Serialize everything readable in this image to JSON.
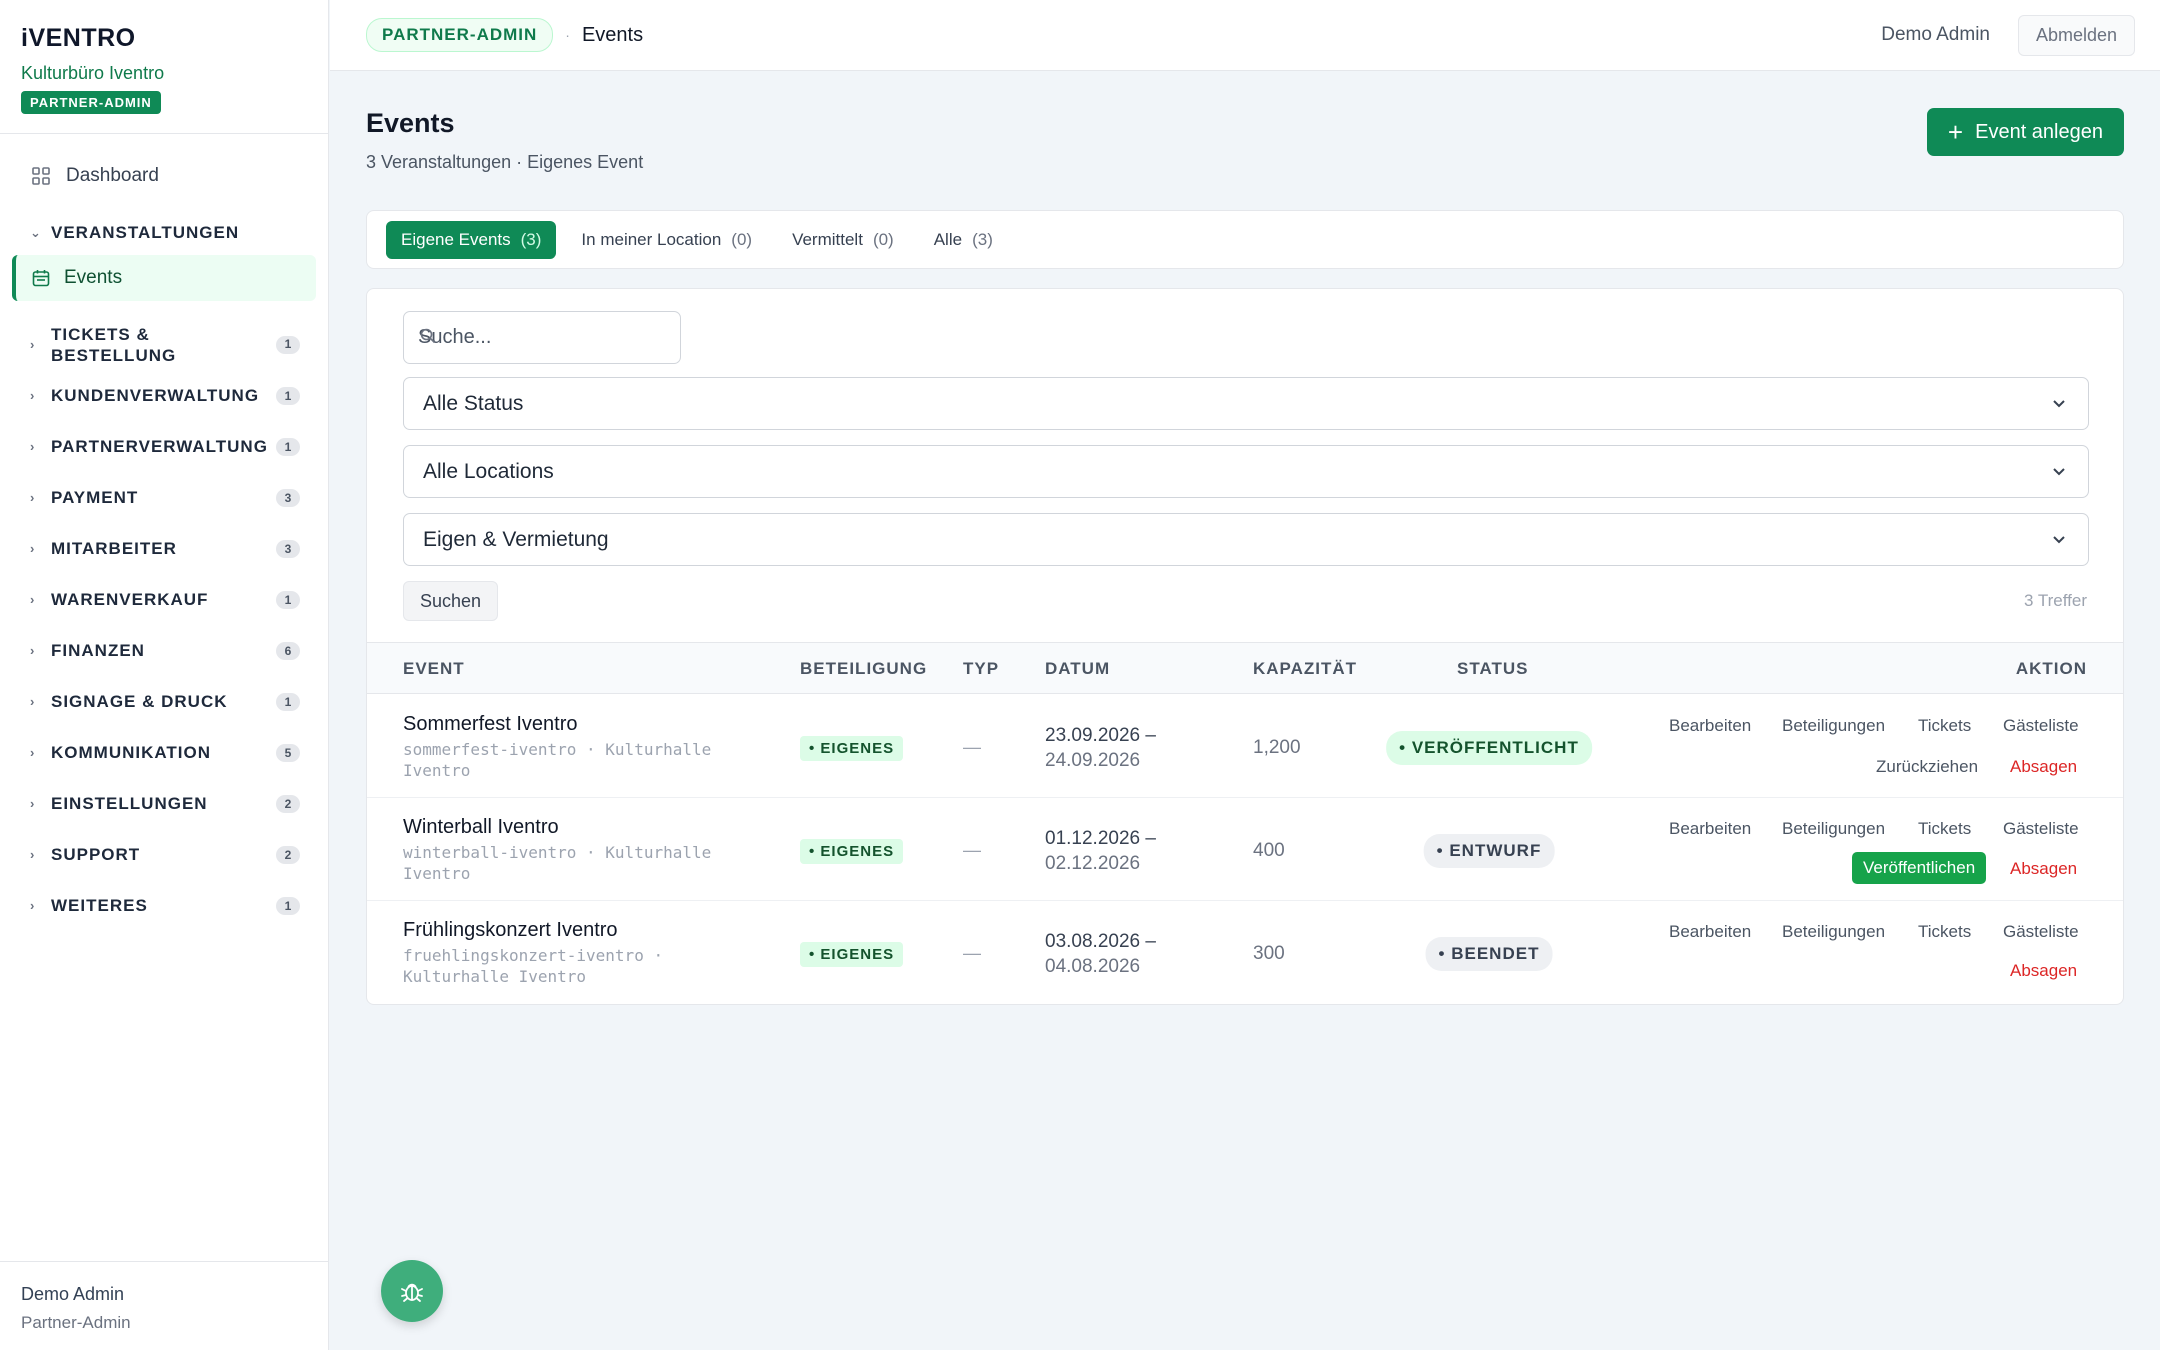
{
  "brand": {
    "logo": "iVENTRO",
    "org": "Kulturbüro Iventro",
    "role": "PARTNER-ADMIN"
  },
  "sidebar": {
    "dashboard": "Dashboard",
    "veranstaltungen": "VERANSTALTUNGEN",
    "events": "Events",
    "groups": [
      {
        "label": "TICKETS &\nBESTELLUNG",
        "count": "1"
      },
      {
        "label": "KUNDENVERWALTUNG",
        "count": "1"
      },
      {
        "label": "PARTNERVERWALTUNG",
        "count": "1"
      },
      {
        "label": "PAYMENT",
        "count": "3"
      },
      {
        "label": "MITARBEITER",
        "count": "3"
      },
      {
        "label": "WARENVERKAUF",
        "count": "1"
      },
      {
        "label": "FINANZEN",
        "count": "6"
      },
      {
        "label": "SIGNAGE & DRUCK",
        "count": "1"
      },
      {
        "label": "KOMMUNIKATION",
        "count": "5"
      },
      {
        "label": "EINSTELLUNGEN",
        "count": "2"
      },
      {
        "label": "SUPPORT",
        "count": "2"
      },
      {
        "label": "WEITERES",
        "count": "1"
      }
    ],
    "footer": {
      "user": "Demo Admin",
      "role": "Partner-Admin"
    }
  },
  "topbar": {
    "badge": "PARTNER-ADMIN",
    "sep": "·",
    "title": "Events",
    "user": "Demo Admin",
    "logout": "Abmelden"
  },
  "header": {
    "title": "Events",
    "subtitle": "3 Veranstaltungen · Eigenes Event",
    "add_button": "Event anlegen"
  },
  "tabs": [
    {
      "label": "Eigene Events",
      "count": "(3)"
    },
    {
      "label": "In meiner Location",
      "count": "(0)"
    },
    {
      "label": "Vermittelt",
      "count": "(0)"
    },
    {
      "label": "Alle",
      "count": "(3)"
    }
  ],
  "filters": {
    "search_placeholder": "Suche...",
    "status": "Alle Status",
    "locations": "Alle Locations",
    "type": "Eigen & Vermietung",
    "search_button": "Suchen",
    "hits": "3 Treffer"
  },
  "table": {
    "headers": {
      "event": "EVENT",
      "beteiligung": "BETEILIGUNG",
      "typ": "TYP",
      "datum": "DATUM",
      "kapazitaet": "KAPAZITÄT",
      "status": "STATUS",
      "aktion": "AKTION"
    },
    "actions": {
      "edit": "Bearbeiten",
      "participations": "Beteiligungen",
      "tickets": "Tickets",
      "guestlist": "Gästeliste",
      "withdraw": "Zurückziehen",
      "publish": "Veröffentlichen",
      "cancel": "Absagen"
    },
    "rows": [
      {
        "name": "Sommerfest Iventro",
        "slug": "sommerfest-iventro · Kulturhalle Iventro",
        "beteiligung": "• EIGENES",
        "typ": "—",
        "date_from": "23.09.2026 –",
        "date_to": "24.09.2026",
        "capacity": "1,200",
        "status": "• VERÖFFENTLICHT"
      },
      {
        "name": "Winterball Iventro",
        "slug": "winterball-iventro · Kulturhalle Iventro",
        "beteiligung": "• EIGENES",
        "typ": "—",
        "date_from": "01.12.2026 –",
        "date_to": "02.12.2026",
        "capacity": "400",
        "status": "• ENTWURF"
      },
      {
        "name": "Frühlingskonzert Iventro",
        "slug": "fruehlingskonzert-iventro · Kulturhalle Iventro",
        "beteiligung": "• EIGENES",
        "typ": "—",
        "date_from": "03.08.2026 –",
        "date_to": "04.08.2026",
        "capacity": "300",
        "status": "• BEENDET"
      }
    ]
  },
  "colors": {
    "accent": "#0f8a56",
    "danger": "#dc2626",
    "publish": "#16a34a"
  }
}
